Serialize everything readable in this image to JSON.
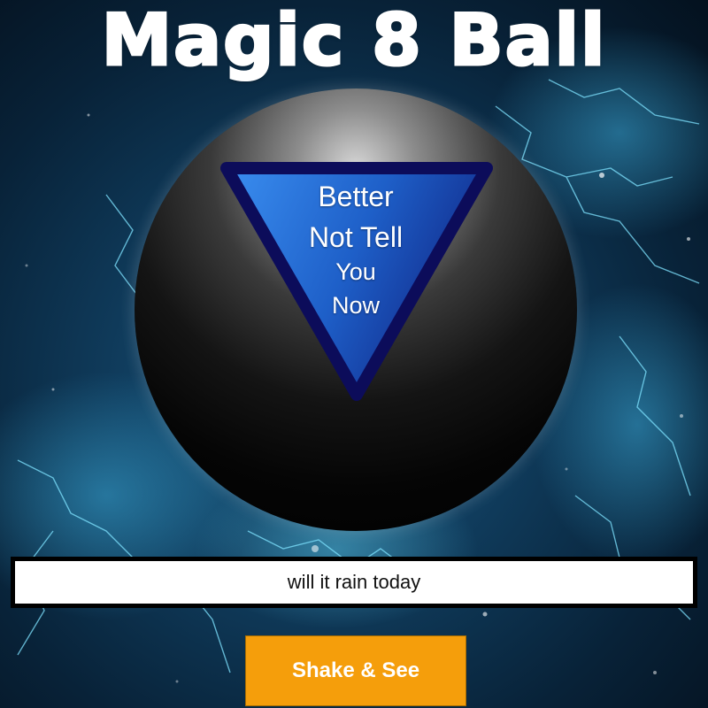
{
  "title": "Magic 8 Ball",
  "ball": {
    "answer_line_1": "Better",
    "answer_line_2": "Not Tell",
    "answer_line_3": "You",
    "answer_line_4": "Now"
  },
  "question": {
    "value": "will it rain today"
  },
  "shake_button": {
    "label": "Shake & See"
  },
  "colors": {
    "triangle_fill": "#2266cc",
    "triangle_border": "#0d0d60",
    "button": "#f59e0b",
    "background": "#0b2f4a"
  }
}
